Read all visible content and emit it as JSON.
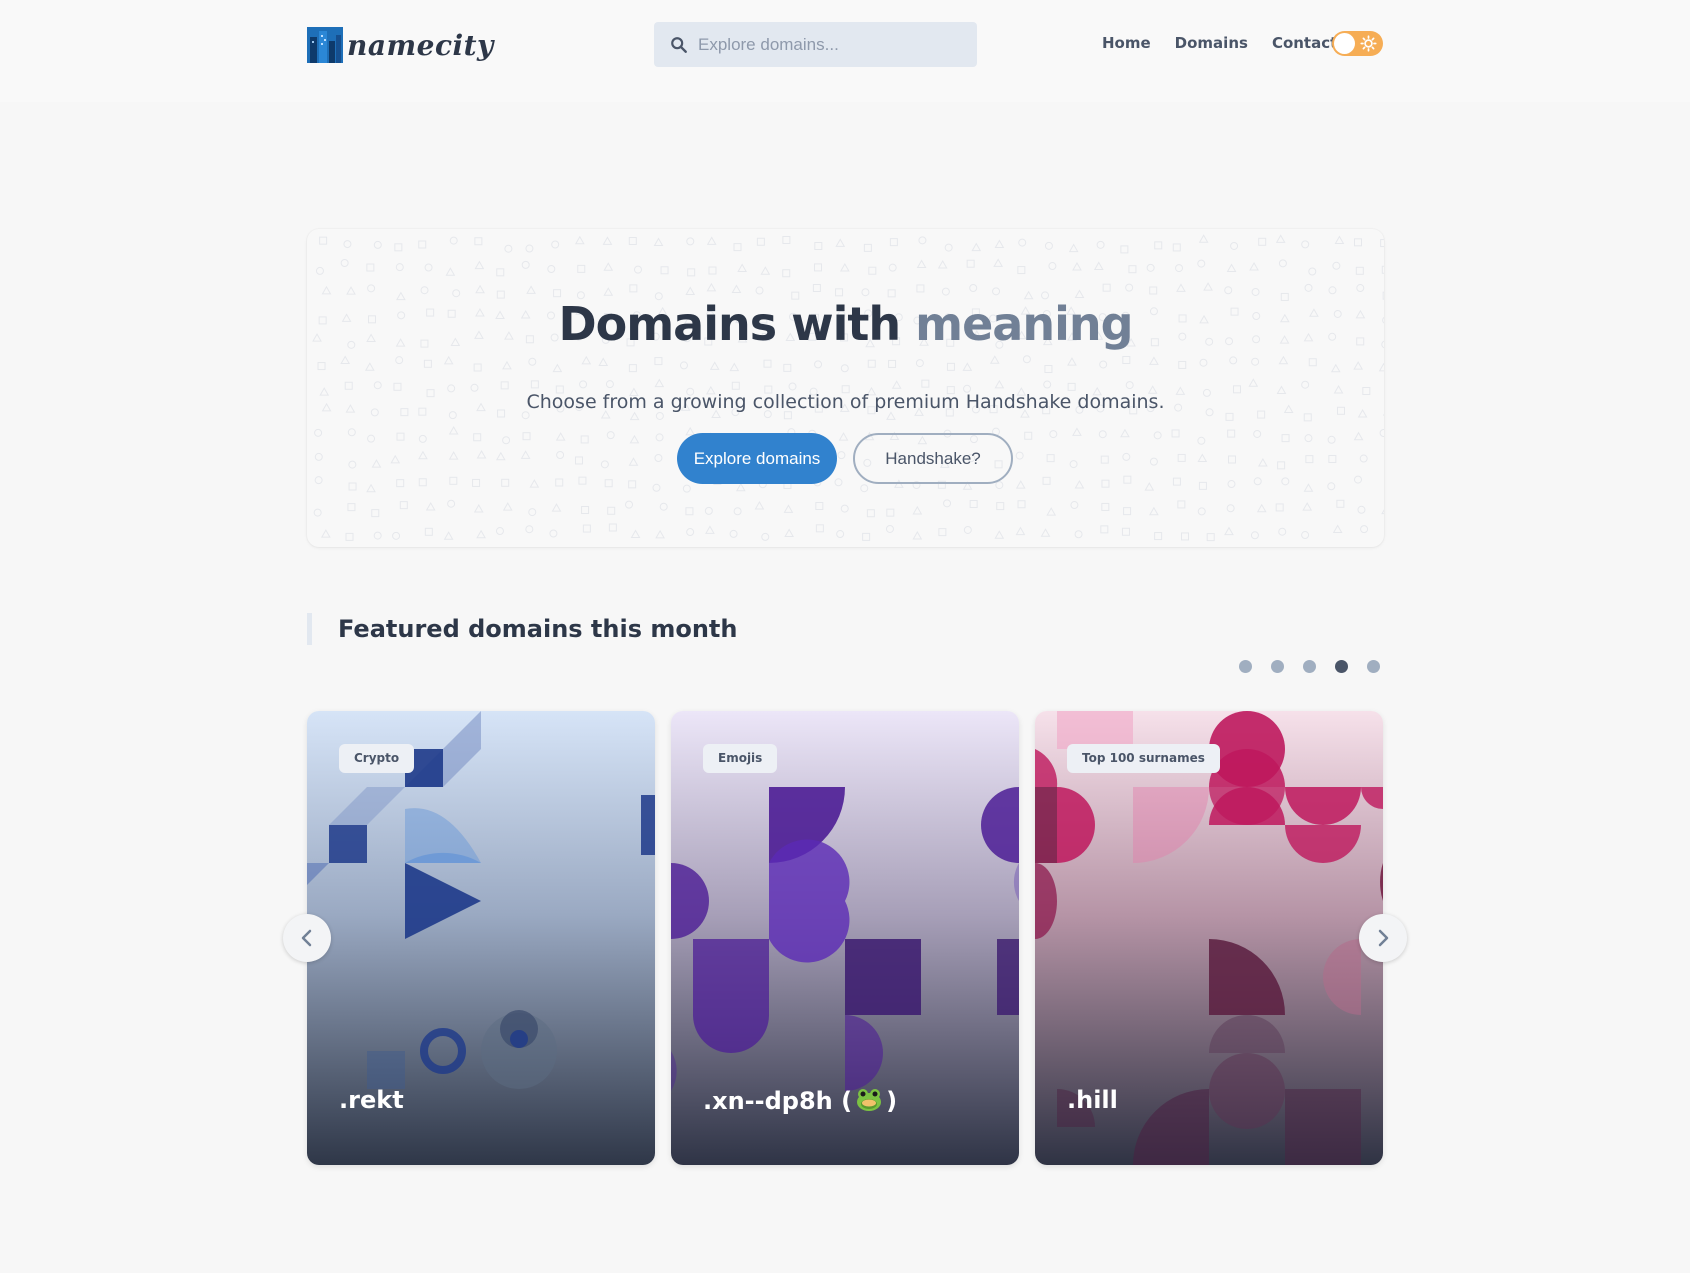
{
  "header": {
    "logo_text": "namecity",
    "search_placeholder": "Explore domains...",
    "nav": [
      {
        "label": "Home"
      },
      {
        "label": "Domains"
      },
      {
        "label": "Contact"
      }
    ],
    "theme_toggle": {
      "state": "light"
    }
  },
  "hero": {
    "title_main": "Domains with",
    "title_accent": "meaning",
    "subtitle": "Choose from a growing collection of premium Handshake domains.",
    "primary_button": "Explore domains",
    "secondary_button": "Handshake?"
  },
  "featured": {
    "title": "Featured domains this month",
    "carousel_page_count": 5,
    "carousel_active_page": 4,
    "cards": [
      {
        "badge": "Crypto",
        "name": ".rekt",
        "accent": "#1e3a8a"
      },
      {
        "badge": "Emojis",
        "name_prefix": ".xn--dp8h (",
        "name_emoji": "frog-face",
        "name_suffix": ")",
        "accent": "#4c1d95"
      },
      {
        "badge": "Top 100 surnames",
        "name": ".hill",
        "accent": "#be185d"
      }
    ]
  },
  "colors": {
    "primary": "#3182ce",
    "toggle": "#f6ad55",
    "heading": "#2d3748",
    "accent_text": "#718096"
  }
}
